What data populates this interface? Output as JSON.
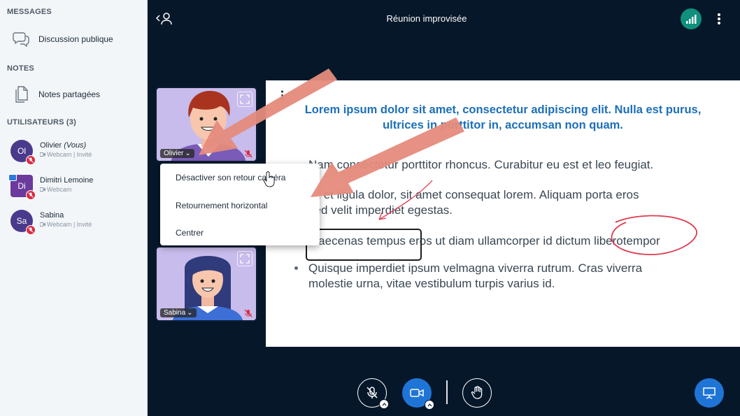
{
  "sidebar": {
    "messages_title": "MESSAGES",
    "public_chat": "Discussion publique",
    "notes_title": "NOTES",
    "shared_notes": "Notes partagées",
    "users_title": "UTILISATEURS (3)",
    "users": [
      {
        "initials": "Ol",
        "name": "Olivier",
        "you": "(Vous)",
        "sub": "Webcam | Invité",
        "color": "#4a3a8c"
      },
      {
        "initials": "Di",
        "name": "Dimitri Lemoine",
        "you": "",
        "sub": "Webcam",
        "color": "#6b3a9c"
      },
      {
        "initials": "Sa",
        "name": "Sabina",
        "you": "",
        "sub": "Webcam | Invité",
        "color": "#4a3a8c"
      }
    ]
  },
  "header": {
    "title": "Réunion improvisée"
  },
  "tiles": [
    {
      "name": "Olivier"
    },
    {
      "name": "Sabina"
    }
  ],
  "context_menu": {
    "items": [
      "Désactiver son retour caméra",
      "Retournement horizontal",
      "Centrer"
    ]
  },
  "slide": {
    "title_line1": "Lorem ipsum dolor sit amet, consectetur adipiscing elit. Nulla est purus,",
    "title_line2": "ultrices in porttitor in, accumsan non quam.",
    "bullets": [
      [
        "Nam consectetur porttitor rhoncus. Curabitur eu est et leo feugiat."
      ],
      [
        "Ut et ligula dolor, sit amet consequat lorem. Aliquam porta eros",
        "sed velit imperdiet egestas."
      ],
      [
        "Maecenas tempus eros ut diam ullamcorper id dictum liberotempor"
      ],
      [
        "Quisque imperdiet ipsum velmagna viverra rutrum. Cras viverra",
        "molestie urna, vitae vestibulum turpis varius id."
      ]
    ]
  },
  "colors": {
    "accent": "#1d6fb8",
    "camera_active": "#1f75d6",
    "mute_red": "#d92c42",
    "arrow": "#e58b7c",
    "annotation_red": "#e0394f"
  }
}
